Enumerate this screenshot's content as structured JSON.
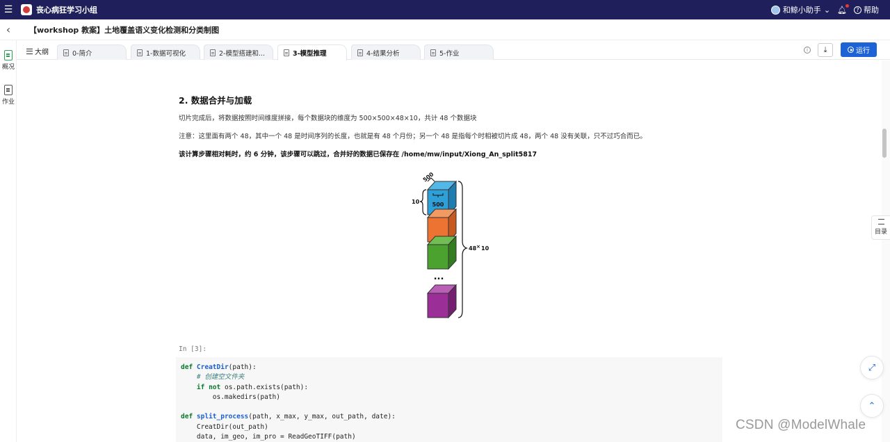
{
  "topbar": {
    "group_name": "丧心病狂学习小组",
    "user_name": "和鲸小助手",
    "help_label": "帮助"
  },
  "doc": {
    "title": "【workshop 教案】土地覆盖语义变化检测和分类制图"
  },
  "leftrail": {
    "items": [
      {
        "label": "概况"
      },
      {
        "label": "作业"
      }
    ]
  },
  "tabs": {
    "outline_label": "大纲",
    "items": [
      {
        "label": "0-简介"
      },
      {
        "label": "1-数据可视化"
      },
      {
        "label": "2-模型搭建和..."
      },
      {
        "label": "3-模型推理"
      },
      {
        "label": "4-结果分析"
      },
      {
        "label": "5-作业"
      }
    ],
    "run_label": "运行"
  },
  "content": {
    "section_title": "2. 数据合并与加载",
    "para1": "切片完成后，将数据按照时间维度拼接，每个数据块的维度为 500×500×48×10，共计 48 个数据块",
    "para2": "注意：这里面有两个 48，其中一个 48 是时间序列的长度，也就是有 48 个月份；另一个 48 是指每个时相被切片成 48，两个 48 没有关联，只不过巧合而已。",
    "para3": "该计算步骤相对耗时，约 6 分钟，该步骤可以跳过，合并好的数据已保存在 /home/mw/input/Xiong_An_split5817"
  },
  "figure": {
    "label_top": "500",
    "label_inner": "500",
    "label_left": "10",
    "label_right_a": "48",
    "label_right_x": "×",
    "label_right_b": "10",
    "ellipsis": "...",
    "colors": {
      "blue": "#2f9fd8",
      "orange": "#ec7332",
      "green": "#4ba22f",
      "purple": "#9b2f97"
    }
  },
  "code": {
    "prompt": "In [3]:",
    "l1_kw": "def",
    "l1_fn": "CreatDir",
    "l1_rest": "(path):",
    "l2_comment": "# 创建空文件夹",
    "l3_kw1": "if",
    "l3_kw2": "not",
    "l3_rest": " os.path.exists(path):",
    "l4": "os.makedirs(path)",
    "l6_kw": "def",
    "l6_fn": "split_process",
    "l6_rest": "(path, x_max, y_max, out_path, date):",
    "l7": "CreatDir(out_path)",
    "l8": "data, im_geo, im_pro = ReadGeoTIFF(path)"
  },
  "toc": {
    "label": "目录"
  },
  "watermark": "CSDN @ModelWhale",
  "icons": [
    "menu-icon",
    "back-icon",
    "bell-icon",
    "help-icon",
    "info-icon",
    "download-icon",
    "run-icon",
    "toc-icon",
    "fullscreen-icon",
    "arrow-up-icon"
  ]
}
